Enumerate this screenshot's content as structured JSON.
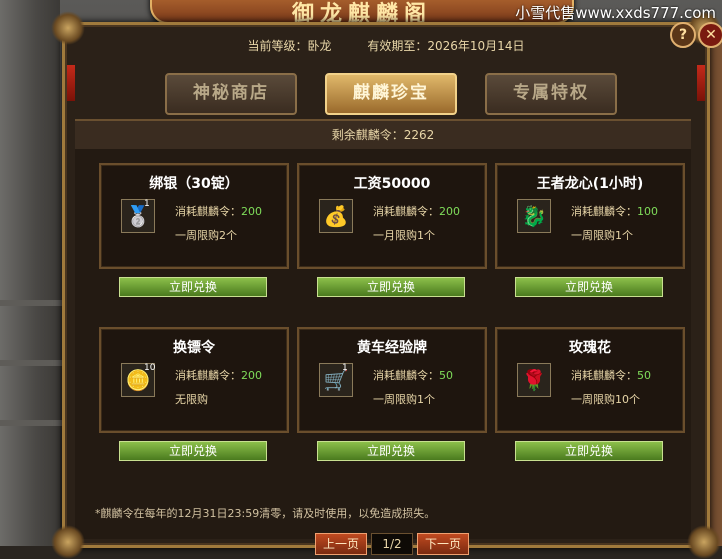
{
  "banner_title": "御龙麒麟阁",
  "watermark": "小雪代售www.xxds777.com",
  "info": {
    "level_label": "当前等级：卧龙",
    "expire_label": "有效期至：2026年10月14日"
  },
  "tabs": [
    {
      "label": "神秘商店",
      "active": false
    },
    {
      "label": "麒麟珍宝",
      "active": true
    },
    {
      "label": "专属特权",
      "active": false
    }
  ],
  "remaining": "剩余麒麟令：2262",
  "cost_prefix": "消耗麒麟令：",
  "exchange_label": "立即兑换",
  "items": [
    {
      "name": "绑银（30锭）",
      "qty": "1",
      "cost": "200",
      "limit": "一周限购2个",
      "icon": "silver-ingot-icon",
      "glyph": "🥈"
    },
    {
      "name": "工资50000",
      "qty": "",
      "cost": "200",
      "limit": "一月限购1个",
      "icon": "gold-coins-icon",
      "glyph": "💰"
    },
    {
      "name": "王者龙心(1小时)",
      "qty": "",
      "cost": "100",
      "limit": "一周限购1个",
      "icon": "dragon-heart-icon",
      "glyph": "🐉"
    },
    {
      "name": "换镖令",
      "qty": "10",
      "cost": "200",
      "limit": "无限购",
      "icon": "escort-token-icon",
      "glyph": "🪙"
    },
    {
      "name": "黄车经验牌",
      "qty": "1",
      "cost": "50",
      "limit": "一周限购1个",
      "icon": "yellow-cart-icon",
      "glyph": "🛒"
    },
    {
      "name": "玫瑰花",
      "qty": "",
      "cost": "50",
      "limit": "一周限购10个",
      "icon": "rose-icon",
      "glyph": "🌹"
    }
  ],
  "notice": "*麒麟令在每年的12月31日23:59清零，请及时使用，以免造成损失。",
  "pager": {
    "prev": "上一页",
    "page": "1/2",
    "next": "下一页"
  },
  "buttons": {
    "help": "?",
    "close": "✕"
  },
  "colors": {
    "accent_green": "#7fdc5a",
    "gold": "#e0b86a",
    "panel_bg": "#2b2118"
  }
}
